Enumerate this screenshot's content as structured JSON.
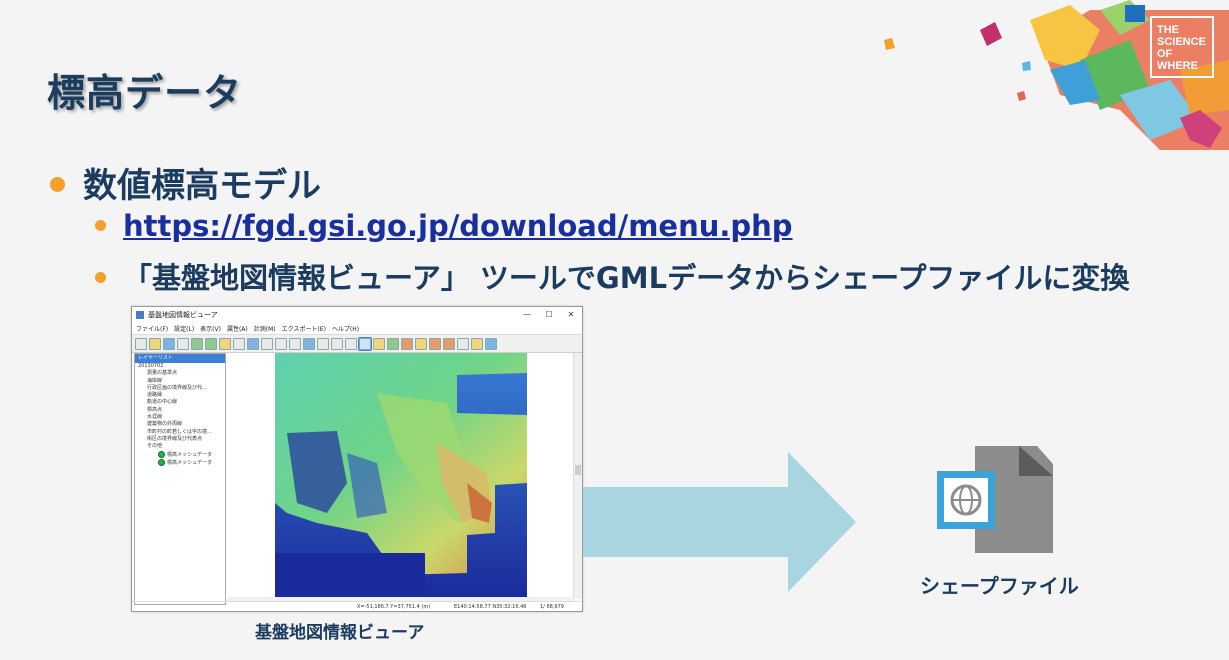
{
  "slide": {
    "title": "標高データ",
    "bullet1": "数値標高モデル",
    "bullet2_link": "https://fgd.gsi.go.jp/download/menu.php",
    "bullet3": "「基盤地図情報ビューア」 ツールでGMLデータからシェープファイルに変換",
    "logo_lines": [
      "THE",
      "SCIENCE",
      "OF",
      "WHERE"
    ],
    "colors": {
      "title": "#1b3c5e",
      "bullet": "#f5a02a",
      "link": "#1a2f9e",
      "arrow": "#a9d5e0",
      "file": "#8c8c8c"
    }
  },
  "viewer": {
    "window_title": "基盤地図情報ビューア",
    "window_buttons": [
      "—",
      "☐",
      "✕"
    ],
    "menus": [
      "ファイル(F)",
      "設定(L)",
      "表示(V)",
      "属性(A)",
      "計測(M)",
      "エクスポート(E)",
      "ヘルプ(H)"
    ],
    "panel_title": "レイヤーリスト",
    "tree": {
      "root": "20130702",
      "items": [
        "測量の基準点",
        "海岸線",
        "行政区画の境界線及び代…",
        "道路縁",
        "軌道の中心線",
        "標高点",
        "水涯線",
        "建築物の外周線",
        "市町村の町若しくは字の境…",
        "街区の境界線及び代表点"
      ],
      "group": "その他",
      "sub_items": [
        "標高メッシュデータ",
        "標高メッシュデータ"
      ]
    },
    "status_left": "X=-51,186.7 Y=37,751.4 (m)",
    "status_mid": "E140:14:58.77 N35:32:16.46",
    "status_right": "1/ 68,979"
  },
  "captions": {
    "viewer": "基盤地図情報ビューア",
    "file": "シェープファイル"
  }
}
